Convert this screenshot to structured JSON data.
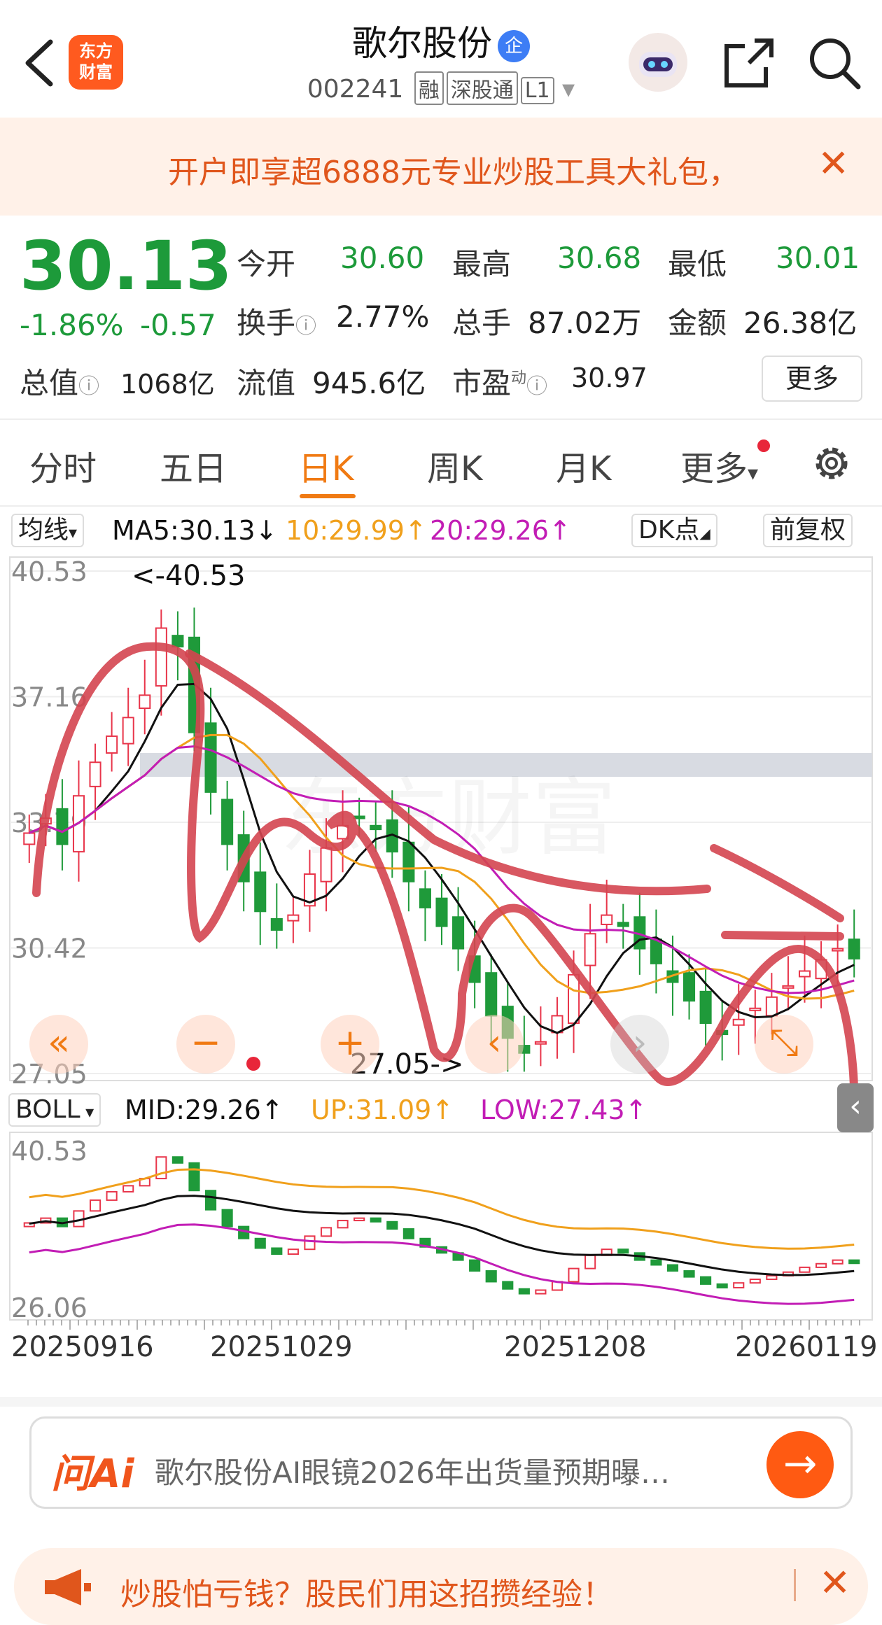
{
  "header": {
    "title": "歌尔股份",
    "badge": "企",
    "code": "002241",
    "tags": [
      "融",
      "深股通",
      "L1"
    ],
    "logo_line1": "东方",
    "logo_line2": "财富"
  },
  "banner": {
    "text": "开户即享超6888元专业炒股工具大礼包，",
    "close": "✕"
  },
  "quote": {
    "price": "30.13",
    "change_pct": "-1.86%",
    "change": "-0.57",
    "open_label": "今开",
    "open": "30.60",
    "high_label": "最高",
    "high": "30.68",
    "low_label": "最低",
    "low": "30.01",
    "turnover_label": "换手",
    "turnover": "2.77%",
    "volume_label": "总手",
    "volume": "87.02万",
    "amount_label": "金额",
    "amount": "26.38亿",
    "mktcap_label": "总值",
    "mktcap": "1068亿",
    "float_label": "流值",
    "float": "945.6亿",
    "pe_label": "市盈",
    "pe_sup": "动",
    "pe": "30.97",
    "more": "更多"
  },
  "tabs": [
    "分时",
    "五日",
    "日K",
    "周K",
    "月K",
    "更多"
  ],
  "ma_bar": {
    "select": "均线",
    "ma5": "MA5:30.13",
    "ma10": "10:29.99",
    "ma20": "20:29.26",
    "dk": "DK点",
    "adj": "前复权",
    "arrow_up": "↑",
    "arrow_down": "↓"
  },
  "boll_bar": {
    "select": "BOLL",
    "mid": "MID:29.26",
    "up": "UP:31.09",
    "low": "LOW:27.43"
  },
  "chart_data": {
    "type": "candlestick",
    "main_axis": {
      "ticks": [
        "40.53",
        "37.16",
        "33.79",
        "30.42",
        "27.05"
      ],
      "ylim": [
        27.05,
        40.53
      ]
    },
    "annotations": {
      "max": "<-40.53",
      "min": "27.05->"
    },
    "boll_axis": {
      "ticks": [
        "40.53",
        "26.06"
      ]
    },
    "dates": [
      "20250916",
      "20251029",
      "20251208",
      "20260119"
    ],
    "close_series": [
      33.5,
      33.9,
      33.2,
      34.5,
      35.4,
      36.1,
      36.6,
      37.2,
      39.0,
      38.5,
      36.2,
      34.6,
      33.2,
      32.2,
      31.4,
      30.9,
      31.3,
      32.4,
      33.1,
      33.7,
      33.9,
      33.6,
      33.0,
      32.2,
      31.5,
      31.0,
      30.4,
      29.5,
      28.6,
      28.0,
      27.6,
      27.9,
      28.6,
      29.7,
      30.8,
      31.3,
      31.0,
      30.4,
      30.0,
      29.5,
      29.0,
      28.4,
      28.1,
      28.5,
      28.8,
      29.1,
      29.4,
      29.8,
      30.1,
      30.4,
      30.13
    ],
    "colors": {
      "up": "#e8354a",
      "down": "#1f9a3a",
      "ma5": "#111111",
      "ma10": "#f0a01c",
      "ma20": "#c21db5"
    }
  },
  "ai": {
    "brand": "问Ai",
    "question": "歌尔股份AI眼镜2026年出货量预期曝…",
    "go": "→"
  },
  "promo": {
    "text": "炒股怕亏钱？股民们用这招攒经验！",
    "close": "✕"
  },
  "watermark": "东方财富"
}
